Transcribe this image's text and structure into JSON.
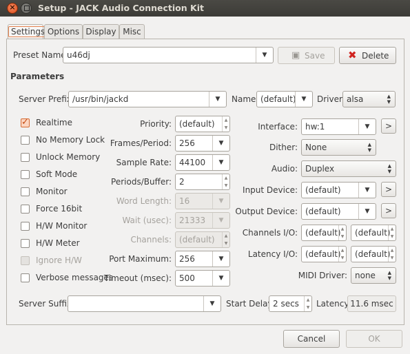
{
  "window": {
    "title": "Setup - JACK Audio Connection Kit"
  },
  "tabs": [
    "Settings",
    "Options",
    "Display",
    "Misc"
  ],
  "preset": {
    "label": "Preset Name:",
    "value": "u46dj",
    "save": "Save",
    "delete": "Delete"
  },
  "parameters": {
    "heading": "Parameters"
  },
  "server_prefix": {
    "label": "Server Prefix:",
    "value": "/usr/bin/jackd"
  },
  "name": {
    "label": "Name:",
    "value": "(default)"
  },
  "driver": {
    "label": "Driver:",
    "value": "alsa"
  },
  "checkboxes": [
    {
      "label": "Realtime",
      "checked": true
    },
    {
      "label": "No Memory Lock",
      "checked": false
    },
    {
      "label": "Unlock Memory",
      "checked": false
    },
    {
      "label": "Soft Mode",
      "checked": false
    },
    {
      "label": "Monitor",
      "checked": false
    },
    {
      "label": "Force 16bit",
      "checked": false
    },
    {
      "label": "H/W Monitor",
      "checked": false
    },
    {
      "label": "H/W Meter",
      "checked": false
    },
    {
      "label": "Ignore H/W",
      "checked": false,
      "disabled": true
    },
    {
      "label": "Verbose messages",
      "checked": false
    }
  ],
  "mid": [
    {
      "label": "Priority:",
      "value": "(default)",
      "kind": "spin"
    },
    {
      "label": "Frames/Period:",
      "value": "256",
      "kind": "combo"
    },
    {
      "label": "Sample Rate:",
      "value": "44100",
      "kind": "combo"
    },
    {
      "label": "Periods/Buffer:",
      "value": "2",
      "kind": "spin"
    },
    {
      "label": "Word Length:",
      "value": "16",
      "kind": "combo",
      "disabled": true
    },
    {
      "label": "Wait (usec):",
      "value": "21333",
      "kind": "combo",
      "disabled": true
    },
    {
      "label": "Channels:",
      "value": "(default)",
      "kind": "spin",
      "disabled": true
    },
    {
      "label": "Port Maximum:",
      "value": "256",
      "kind": "combo"
    },
    {
      "label": "Timeout (msec):",
      "value": "500",
      "kind": "combo"
    }
  ],
  "right": {
    "interface": {
      "label": "Interface:",
      "value": "hw:1",
      "more": ">"
    },
    "dither": {
      "label": "Dither:",
      "value": "None"
    },
    "audio": {
      "label": "Audio:",
      "value": "Duplex"
    },
    "input_device": {
      "label": "Input Device:",
      "value": "(default)",
      "more": ">"
    },
    "output_device": {
      "label": "Output Device:",
      "value": "(default)",
      "more": ">"
    },
    "channels_io": {
      "label": "Channels I/O:",
      "in": "(default)",
      "out": "(default)"
    },
    "latency_io": {
      "label": "Latency I/O:",
      "in": "(default)",
      "out": "(default)"
    },
    "midi_driver": {
      "label": "MIDI Driver:",
      "value": "none"
    }
  },
  "server_suffix": {
    "label": "Server Suffix:",
    "value": ""
  },
  "start_delay": {
    "label": "Start Delay:",
    "value": "2 secs"
  },
  "latency": {
    "label": "Latency:",
    "value": "11.6 msec"
  },
  "footer": {
    "cancel": "Cancel",
    "ok": "OK"
  },
  "colors": {
    "accent": "#df4b16",
    "titlebar": "#3c3b37",
    "window_bg": "#f2f1f0"
  }
}
